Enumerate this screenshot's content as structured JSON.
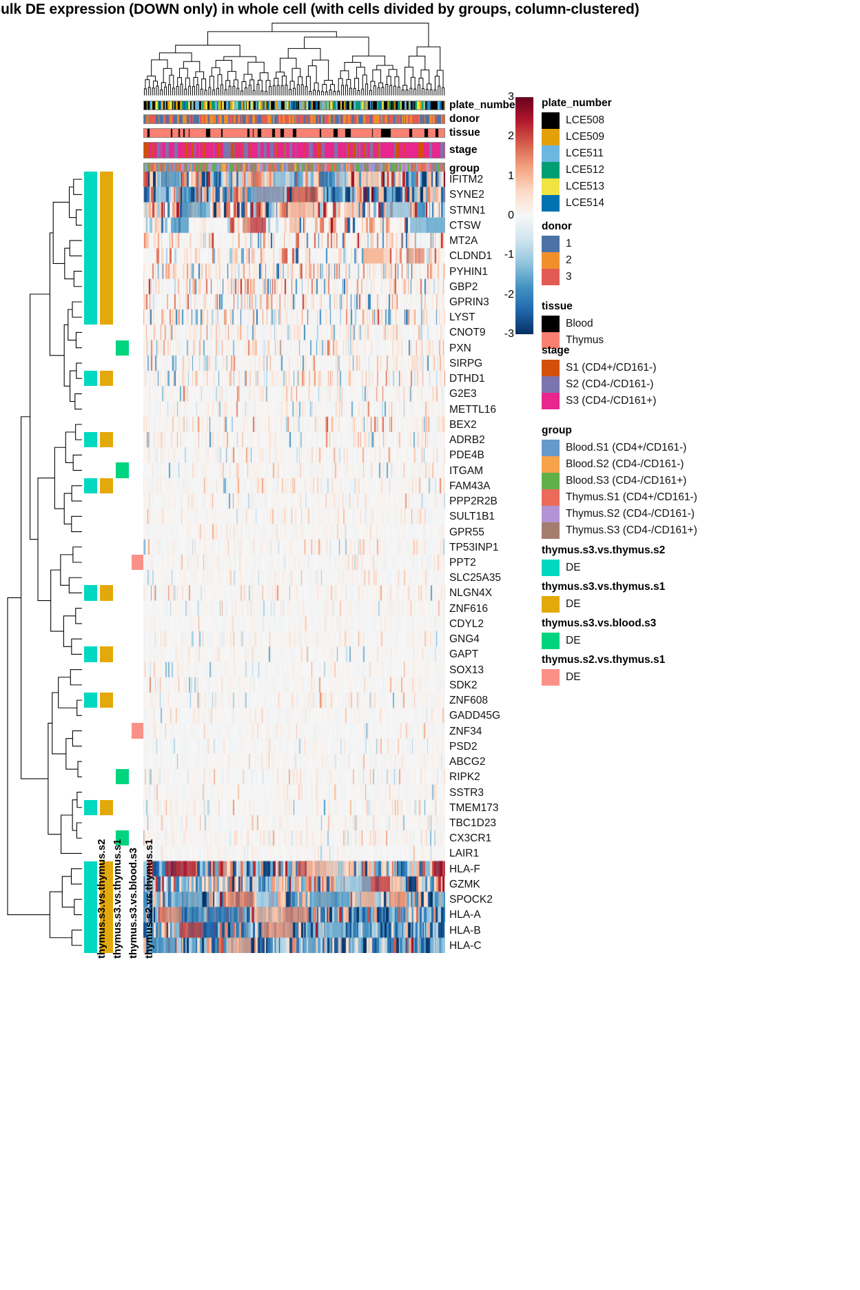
{
  "title": "Bulk DE expression (DOWN only) in whole cell (with cells divided by groups, column-clustered)",
  "column_annotations": [
    {
      "name": "plate_number",
      "label": "plate_number"
    },
    {
      "name": "donor",
      "label": "donor"
    },
    {
      "name": "tissue",
      "label": "tissue"
    },
    {
      "name": "stage",
      "label": "stage"
    },
    {
      "name": "group",
      "label": "group"
    }
  ],
  "colorbar": {
    "ticks": [
      "3",
      "2",
      "1",
      "0",
      "-1",
      "-2",
      "-3"
    ],
    "values": [
      3,
      2,
      1,
      0,
      -1,
      -2,
      -3
    ],
    "high_color": "#67001f",
    "mid_color": "#f7f7f7",
    "low_color": "#053061"
  },
  "legends": [
    {
      "name": "plate_number",
      "title": "plate_number",
      "items": [
        {
          "label": "LCE508",
          "color": "#000000"
        },
        {
          "label": "LCE509",
          "color": "#E3A008"
        },
        {
          "label": "LCE511",
          "color": "#6CB7E0"
        },
        {
          "label": "LCE512",
          "color": "#009E73"
        },
        {
          "label": "LCE513",
          "color": "#F0E442"
        },
        {
          "label": "LCE514",
          "color": "#0072B2"
        }
      ]
    },
    {
      "name": "donor",
      "title": "donor",
      "items": [
        {
          "label": "1",
          "color": "#4C72A8"
        },
        {
          "label": "2",
          "color": "#F18F2C"
        },
        {
          "label": "3",
          "color": "#E25B54"
        }
      ]
    },
    {
      "name": "tissue",
      "title": "tissue",
      "items": [
        {
          "label": "Blood",
          "color": "#000000"
        },
        {
          "label": "Thymus",
          "color": "#FA8072"
        }
      ]
    },
    {
      "name": "stage",
      "title": "stage",
      "items": [
        {
          "label": "S1 (CD4+/CD161-)",
          "color": "#D2500A"
        },
        {
          "label": "S2 (CD4-/CD161-)",
          "color": "#7C74AE"
        },
        {
          "label": "S3 (CD4-/CD161+)",
          "color": "#E8268D"
        }
      ]
    },
    {
      "name": "group",
      "title": "group",
      "items": [
        {
          "label": "Blood.S1 (CD4+/CD161-)",
          "color": "#6699CC"
        },
        {
          "label": "Blood.S2 (CD4-/CD161-)",
          "color": "#F7A34B"
        },
        {
          "label": "Blood.S3 (CD4-/CD161+)",
          "color": "#60B04A"
        },
        {
          "label": "Thymus.S1 (CD4+/CD161-)",
          "color": "#EB6A5A"
        },
        {
          "label": "Thymus.S2 (CD4-/CD161-)",
          "color": "#B393D3"
        },
        {
          "label": "Thymus.S3 (CD4-/CD161+)",
          "color": "#A57D6E"
        }
      ]
    },
    {
      "name": "thymus.s3.vs.thymus.s2",
      "title": "thymus.s3.vs.thymus.s2",
      "items": [
        {
          "label": "DE",
          "color": "#00D8C0"
        }
      ]
    },
    {
      "name": "thymus.s3.vs.thymus.s1",
      "title": "thymus.s3.vs.thymus.s1",
      "items": [
        {
          "label": "DE",
          "color": "#E3A80A"
        }
      ]
    },
    {
      "name": "thymus.s3.vs.blood.s3",
      "title": "thymus.s3.vs.blood.s3",
      "items": [
        {
          "label": "DE",
          "color": "#00D47E"
        }
      ]
    },
    {
      "name": "thymus.s2.vs.thymus.s1",
      "title": "thymus.s2.vs.thymus.s1",
      "items": [
        {
          "label": "DE",
          "color": "#FA9189"
        }
      ]
    }
  ],
  "row_annotation_columns": [
    {
      "name": "thymus.s3.vs.thymus.s2",
      "label": "thymus.s3.vs.thymus.s2",
      "color": "#00D8C0"
    },
    {
      "name": "thymus.s3.vs.thymus.s1",
      "label": "thymus.s3.vs.thymus.s1",
      "color": "#E3A80A"
    },
    {
      "name": "thymus.s3.vs.blood.s3",
      "label": "thymus.s3.vs.blood.s3",
      "color": "#00D47E"
    },
    {
      "name": "thymus.s2.vs.thymus.s1",
      "label": "thymus.s2.vs.thymus.s1",
      "color": "#FA9189"
    }
  ],
  "chart_data": {
    "type": "heatmap",
    "title": "Bulk DE expression (DOWN only) in whole cell (with cells divided by groups, column-clustered)",
    "xlabel": "",
    "ylabel": "",
    "zlim": [
      -3,
      3
    ],
    "colorscale": "RdBu reversed",
    "n_columns": 438,
    "genes": [
      "IFITM2",
      "SYNE2",
      "STMN1",
      "CTSW",
      "MT2A",
      "CLDND1",
      "PYHIN1",
      "GBP2",
      "GPRIN3",
      "LYST",
      "CNOT9",
      "PXN",
      "SIRPG",
      "DTHD1",
      "G2E3",
      "METTL16",
      "BEX2",
      "ADRB2",
      "PDE4B",
      "ITGAM",
      "FAM43A",
      "PPP2R2B",
      "SULT1B1",
      "GPR55",
      "TP53INP1",
      "PPT2",
      "SLC25A35",
      "NLGN4X",
      "ZNF616",
      "CDYL2",
      "GNG4",
      "GAPT",
      "SOX13",
      "SDK2",
      "ZNF608",
      "GADD45G",
      "ZNF34",
      "PSD2",
      "ABCG2",
      "RIPK2",
      "SSTR3",
      "TMEM173",
      "TBC1D23",
      "CX3CR1",
      "LAIR1",
      "HLA-F",
      "GZMK",
      "SPOCK2",
      "HLA-A",
      "HLA-B",
      "HLA-C"
    ],
    "row_de_flags": {
      "thymus.s3.vs.thymus.s2": [
        true,
        true,
        true,
        true,
        true,
        true,
        true,
        true,
        true,
        true,
        false,
        false,
        false,
        true,
        false,
        false,
        false,
        true,
        false,
        false,
        true,
        false,
        false,
        false,
        false,
        false,
        false,
        true,
        false,
        false,
        false,
        true,
        false,
        false,
        true,
        false,
        false,
        false,
        false,
        false,
        false,
        true,
        false,
        false,
        false,
        true,
        true,
        true,
        true,
        true,
        true
      ],
      "thymus.s3.vs.thymus.s1": [
        true,
        true,
        true,
        true,
        true,
        true,
        true,
        true,
        true,
        true,
        false,
        false,
        false,
        true,
        false,
        false,
        false,
        true,
        false,
        false,
        true,
        false,
        false,
        false,
        false,
        false,
        false,
        true,
        false,
        false,
        false,
        true,
        false,
        false,
        true,
        false,
        false,
        false,
        false,
        false,
        false,
        true,
        false,
        false,
        false,
        true,
        true,
        true,
        true,
        true,
        true
      ],
      "thymus.s3.vs.blood.s3": [
        false,
        false,
        false,
        false,
        false,
        false,
        false,
        false,
        false,
        false,
        false,
        true,
        false,
        false,
        false,
        false,
        false,
        false,
        false,
        true,
        false,
        false,
        false,
        false,
        false,
        false,
        false,
        false,
        false,
        false,
        false,
        false,
        false,
        false,
        false,
        false,
        false,
        false,
        false,
        true,
        false,
        false,
        false,
        true,
        false,
        false,
        false,
        false,
        false,
        false,
        false
      ],
      "thymus.s2.vs.thymus.s1": [
        false,
        false,
        false,
        false,
        false,
        false,
        false,
        false,
        false,
        false,
        false,
        false,
        false,
        false,
        false,
        false,
        false,
        false,
        false,
        false,
        false,
        false,
        false,
        false,
        false,
        true,
        false,
        false,
        false,
        false,
        false,
        false,
        false,
        false,
        false,
        false,
        true,
        false,
        false,
        false,
        false,
        false,
        false,
        false,
        false,
        false,
        false,
        false,
        false,
        false,
        false
      ]
    },
    "row_intensity_profile": [
      0.95,
      0.95,
      0.9,
      0.55,
      0.5,
      0.55,
      0.5,
      0.45,
      0.45,
      0.4,
      0.3,
      0.3,
      0.3,
      0.32,
      0.25,
      0.22,
      0.3,
      0.28,
      0.24,
      0.2,
      0.22,
      0.18,
      0.16,
      0.16,
      0.18,
      0.14,
      0.14,
      0.2,
      0.12,
      0.12,
      0.16,
      0.18,
      0.12,
      0.14,
      0.16,
      0.1,
      0.12,
      0.1,
      0.1,
      0.12,
      0.1,
      0.22,
      0.12,
      0.2,
      0.1,
      0.95,
      0.9,
      0.9,
      0.95,
      0.98,
      0.95
    ],
    "row_blue_weight": [
      0.45,
      0.6,
      0.25,
      0.12,
      0.1,
      0.1,
      0.08,
      0.08,
      0.08,
      0.1,
      0.05,
      0.05,
      0.05,
      0.05,
      0.04,
      0.04,
      0.04,
      0.04,
      0.03,
      0.03,
      0.03,
      0.03,
      0.02,
      0.02,
      0.02,
      0.02,
      0.02,
      0.02,
      0.02,
      0.02,
      0.02,
      0.02,
      0.02,
      0.02,
      0.02,
      0.02,
      0.02,
      0.02,
      0.02,
      0.02,
      0.02,
      0.03,
      0.02,
      0.03,
      0.02,
      0.5,
      0.45,
      0.5,
      0.75,
      0.85,
      0.8
    ]
  }
}
